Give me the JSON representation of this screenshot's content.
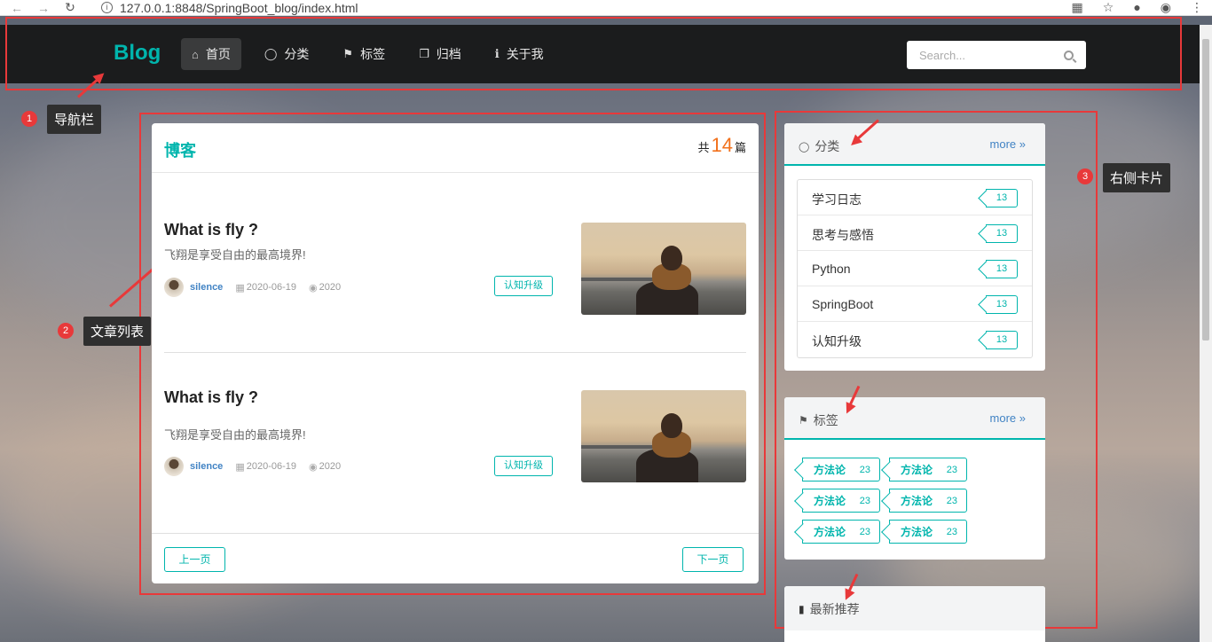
{
  "browser": {
    "url": "127.0.0.1:8848/SpringBoot_blog/index.html"
  },
  "navbar": {
    "brand": "Blog",
    "items": [
      {
        "label": "首页",
        "icon": "home-icon",
        "active": true
      },
      {
        "label": "分类",
        "icon": "lightbulb-icon"
      },
      {
        "label": "标签",
        "icon": "tags-icon"
      },
      {
        "label": "归档",
        "icon": "clone-icon"
      },
      {
        "label": "关于我",
        "icon": "info-icon"
      }
    ],
    "search_placeholder": "Search..."
  },
  "annotations": [
    {
      "number": "1",
      "label": "导航栏"
    },
    {
      "number": "2",
      "label": "文章列表"
    },
    {
      "number": "3",
      "label": "右侧卡片"
    }
  ],
  "main": {
    "title": "博客",
    "total_prefix": "共",
    "total_count": "14",
    "total_suffix": "篇",
    "posts": [
      {
        "title": "What is fly ?",
        "description": "飞翔是享受自由的最高境界!",
        "author": "silence",
        "date": "2020-06-19",
        "views": "2020",
        "tag": "认知升级"
      },
      {
        "title": "What is fly ?",
        "description": "飞翔是享受自由的最高境界!",
        "author": "silence",
        "date": "2020-06-19",
        "views": "2020",
        "tag": "认知升级"
      }
    ],
    "prev_label": "上一页",
    "next_label": "下一页"
  },
  "sidebar": {
    "categories": {
      "title": "分类",
      "more": "more",
      "items": [
        {
          "name": "学习日志",
          "count": "13"
        },
        {
          "name": "思考与感悟",
          "count": "13"
        },
        {
          "name": "Python",
          "count": "13"
        },
        {
          "name": "SpringBoot",
          "count": "13"
        },
        {
          "name": "认知升级",
          "count": "13"
        }
      ]
    },
    "tags": {
      "title": "标签",
      "more": "more",
      "items": [
        {
          "name": "方法论",
          "count": "23"
        },
        {
          "name": "方法论",
          "count": "23"
        },
        {
          "name": "方法论",
          "count": "23"
        },
        {
          "name": "方法论",
          "count": "23"
        },
        {
          "name": "方法论",
          "count": "23"
        },
        {
          "name": "方法论",
          "count": "23"
        }
      ]
    },
    "recommend": {
      "title": "最新推荐"
    }
  },
  "colors": {
    "accent": "#00b5ad",
    "annotation": "#e8393a",
    "navbar": "#1b1c1d",
    "count_highlight": "#f2711c"
  }
}
